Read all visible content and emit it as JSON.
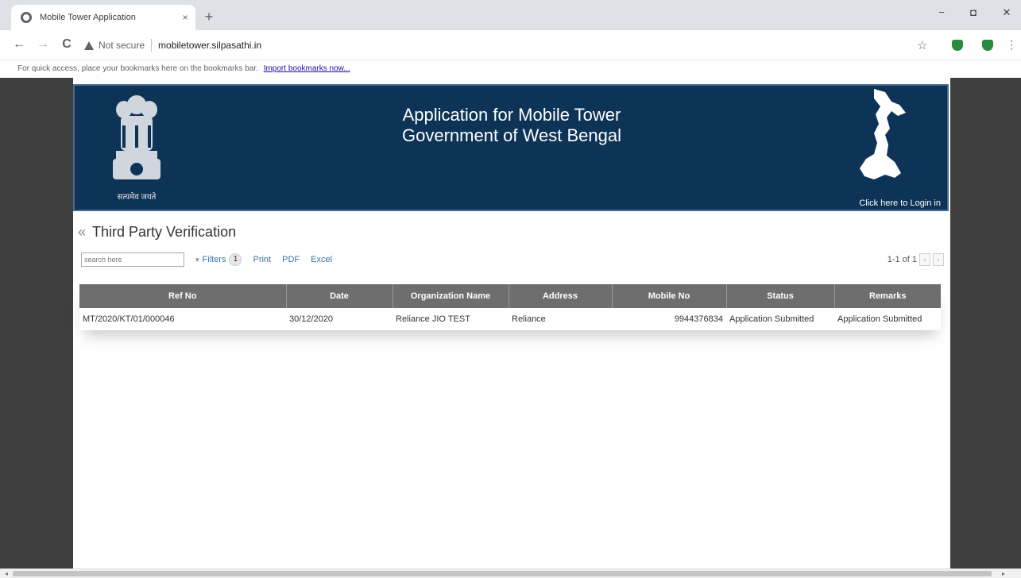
{
  "browser": {
    "tab_title": "Mobile Tower Application",
    "tab_close": "×",
    "new_tab": "+",
    "minimize": "−",
    "maximize": "◘",
    "close": "✕",
    "back": "←",
    "forward": "→",
    "reload": "C",
    "security_label": "Not secure",
    "url": "mobiletower.silpasathi.in",
    "bookmarks_hint": "For quick access, place your bookmarks here on the bookmarks bar.",
    "bookmarks_link": "Import bookmarks now..."
  },
  "banner": {
    "motto": "सत्यमेव जयते",
    "title_line1": "Application for Mobile Tower",
    "title_line2": "Government of West Bengal",
    "login_link": "Click here to Login in"
  },
  "page": {
    "title": "Third Party Verification",
    "back_icon": "«"
  },
  "controls": {
    "search_placeholder": "search here",
    "filters_label": "Filters",
    "filters_count": "1",
    "print_label": "Print",
    "pdf_label": "PDF",
    "excel_label": "Excel",
    "pager_text": "1-1 of 1",
    "prev": "‹",
    "next": "›"
  },
  "table": {
    "headers": [
      "Ref No",
      "Date",
      "Organization Name",
      "Address",
      "Mobile No",
      "Status",
      "Remarks"
    ],
    "rows": [
      {
        "ref_no": "MT/2020/KT/01/000046",
        "date": "30/12/2020",
        "organization": "Reliance JIO TEST",
        "address": "Reliance",
        "mobile": "9944376834",
        "status": "Application Submitted",
        "remarks": "Application Submitted"
      }
    ]
  },
  "colors": {
    "banner_bg": "#0d3457",
    "header_bg": "#6e6e6e",
    "link_blue": "#3874a8",
    "side_bg": "#3f3f3f"
  }
}
